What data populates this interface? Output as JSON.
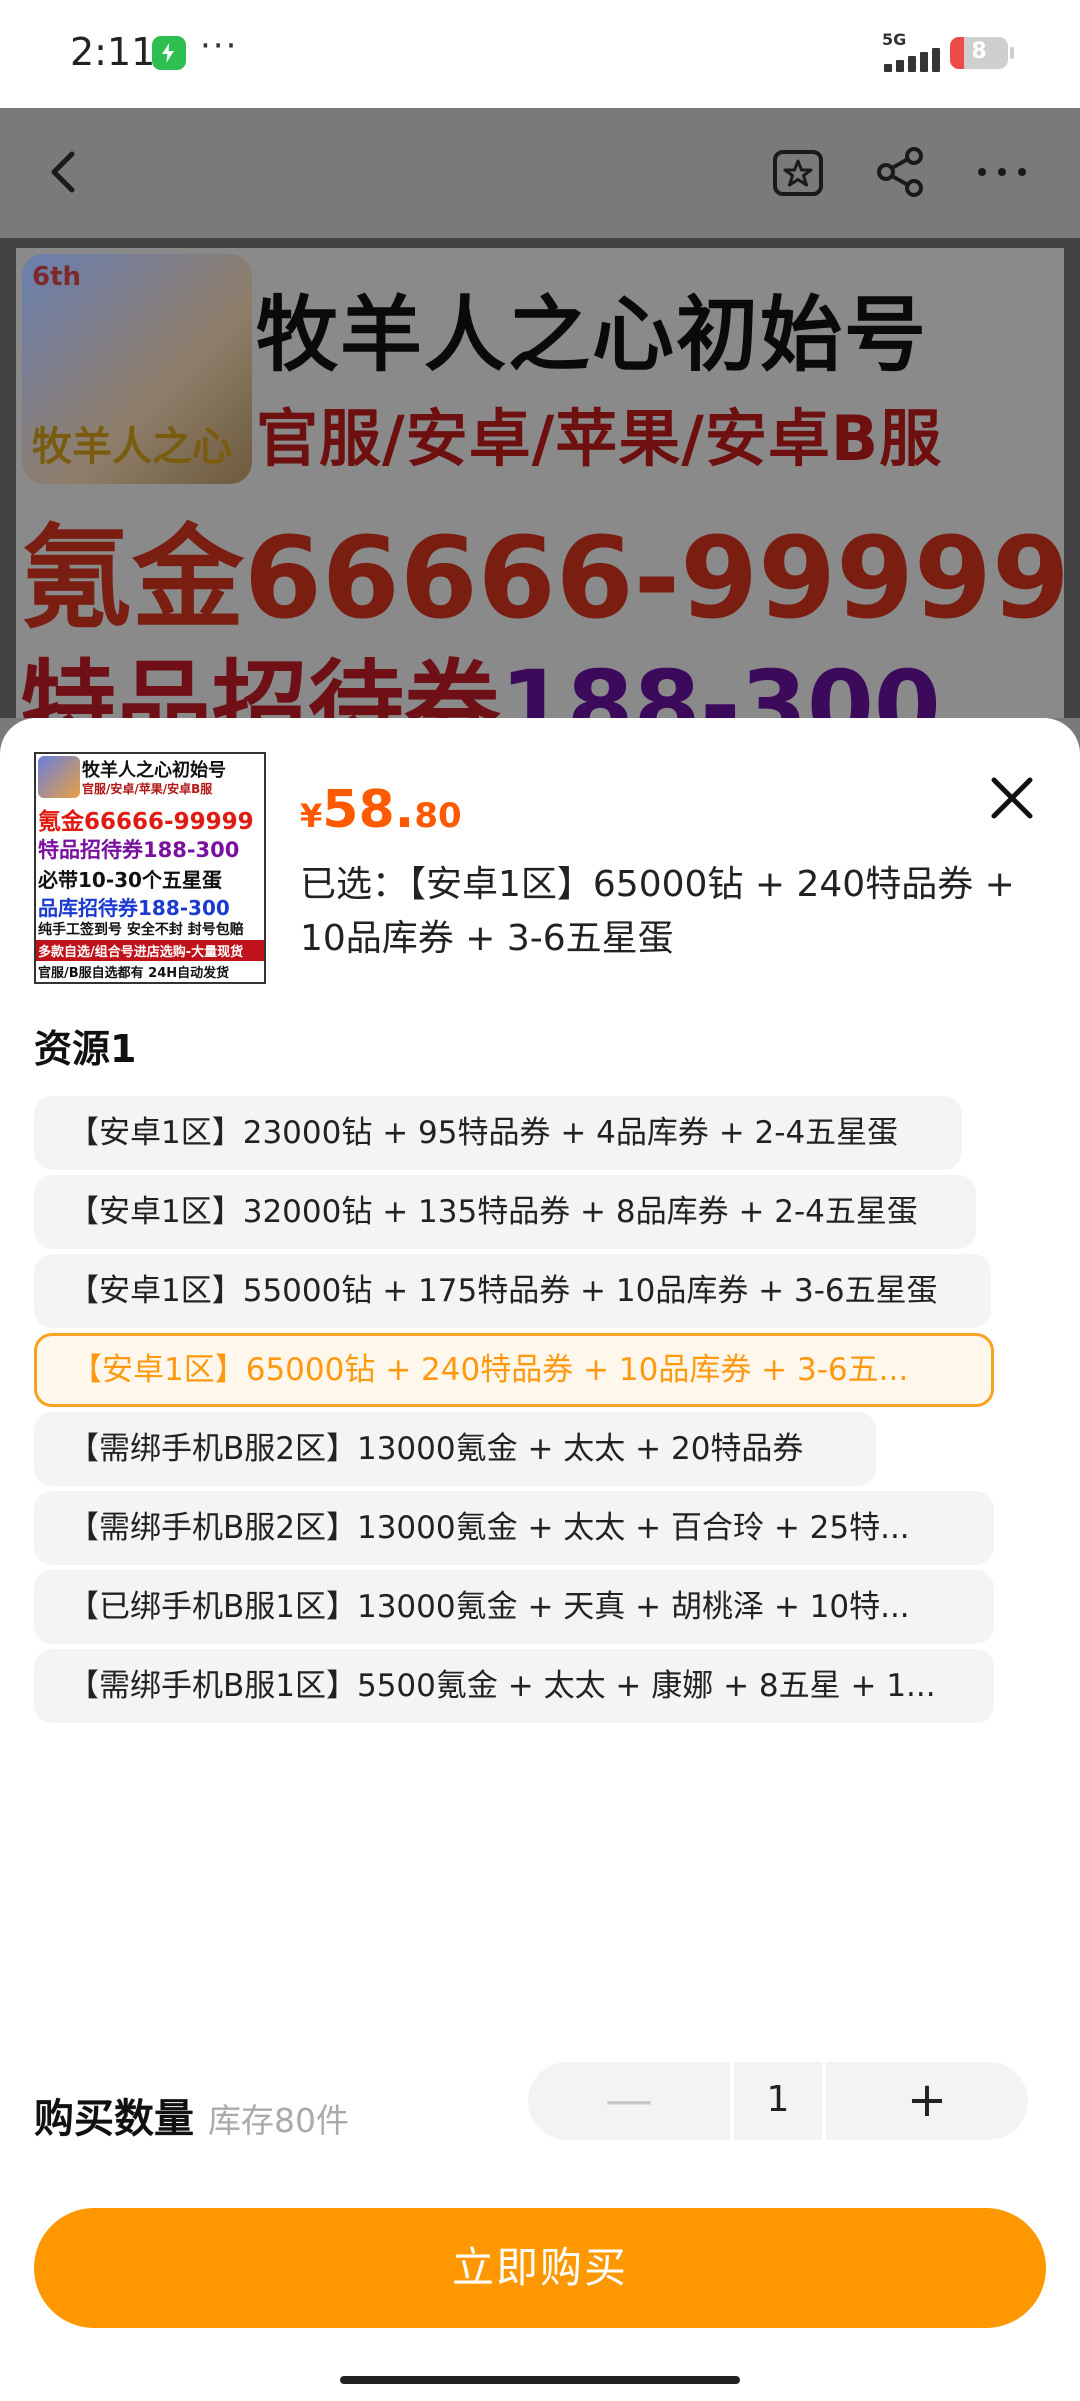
{
  "status_bar": {
    "time": "2:11",
    "dots": "···",
    "network": "5G",
    "battery": "8",
    "colors": {
      "app_icon": "#2fbf50",
      "battery_low": "#ee4a4a"
    }
  },
  "nav": {
    "back_icon": "chevron-left-icon",
    "favorite_icon": "star-box-icon",
    "share_icon": "share-icon",
    "more_icon": "more-icon"
  },
  "banner": {
    "badge": "6th",
    "logo_text": "牧羊人之心",
    "line1": "牧羊人之心初始号",
    "line2": "官服/安卓/苹果/安卓B服",
    "line3": "氪金66666-99999",
    "line4_a": "特品招待券",
    "line4_b": "188-300"
  },
  "sheet": {
    "thumbnail": {
      "l1": "牧羊人之心初始号",
      "l2": "官服/安卓/苹果/安卓B服",
      "l3": "氪金66666-99999",
      "l4": "特品招待券188-300",
      "l5": "必带10-30个五星蛋",
      "l6": "品库招待券188-300",
      "l7": "纯手工签到号 安全不封 封号包赔",
      "l8": "多款自选/组合号进店选购-大量现货",
      "l9": "官服/B服自选都有 24H自动发货"
    },
    "price": {
      "currency": "¥",
      "integer": "58.",
      "decimal": "80",
      "color": "#ff5a00"
    },
    "selected_text": "已选：【安卓1区】65000钻 + 240特品券 + 10品库券 + 3-6五星蛋",
    "close_icon": "close-icon",
    "section_title": "资源1",
    "options": [
      {
        "label": "【安卓1区】23000钻 + 95特品券 + 4品库券 + 2-4五星蛋"
      },
      {
        "label": "【安卓1区】32000钻 + 135特品券 + 8品库券 + 2-4五星蛋"
      },
      {
        "label": "【安卓1区】55000钻 + 175特品券 + 10品库券 + 3-6五星蛋"
      },
      {
        "label": "【安卓1区】65000钻 + 240特品券 + 10品库券 + 3-6五..."
      },
      {
        "label": "【需绑手机B服2区】13000氪金 + 太太 + 20特品券"
      },
      {
        "label": "【需绑手机B服2区】13000氪金 + 太太 + 百合玲 + 25特..."
      },
      {
        "label": "【已绑手机B服1区】13000氪金 + 天真 + 胡桃泽 + 10特..."
      },
      {
        "label": "【需绑手机B服1区】5500氪金 + 太太 + 康娜 + 8五星 + 1..."
      }
    ],
    "selected_index": 3,
    "qty_label": "购买数量",
    "stock": "库存80件",
    "stepper": {
      "minus": "—",
      "value": "1",
      "plus": "+"
    },
    "buy_button": "立即购买",
    "accent": "#ff9800"
  }
}
